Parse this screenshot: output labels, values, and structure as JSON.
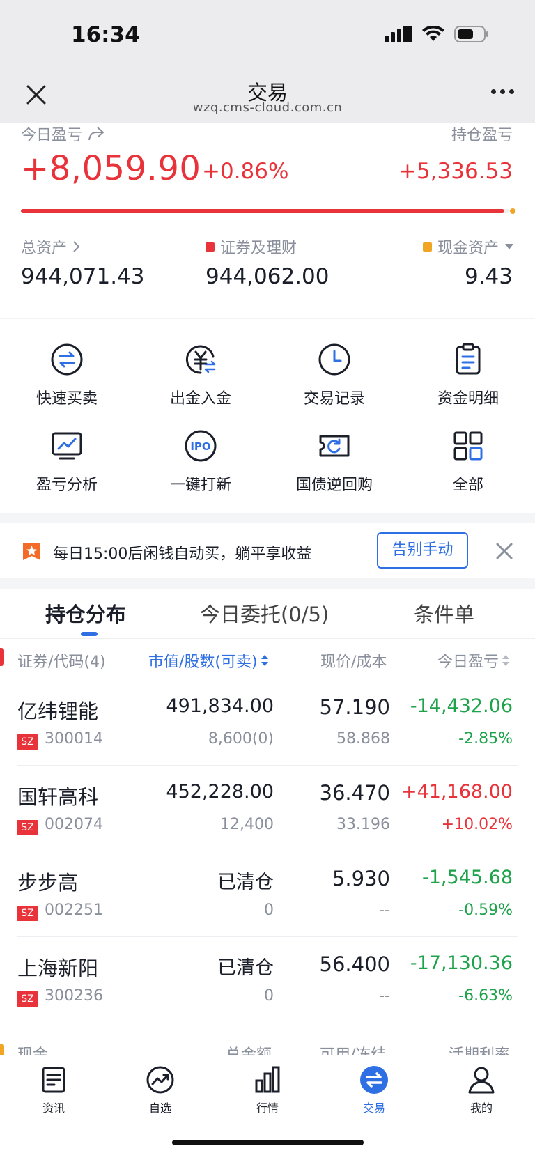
{
  "status": {
    "time": "16:34"
  },
  "nav": {
    "title": "交易",
    "url": "wzq.cms-cloud.com.cn"
  },
  "summary": {
    "today_pl_label": "今日盈亏",
    "holding_pl_label": "持仓盈亏",
    "today_pl": "+8,059.90",
    "today_pl_pct": "+0.86%",
    "holding_pl": "+5,336.53",
    "total_assets_label": "总资产",
    "securities_label": "证券及理财",
    "cash_label": "现金资产",
    "total_assets": "944,071.43",
    "securities_value": "944,062.00",
    "cash_value": "9.43",
    "securities_share": 0.99999
  },
  "shortcuts": [
    {
      "label": "快速买卖",
      "icon": "swap-circle-icon"
    },
    {
      "label": "出金入金",
      "icon": "yuan-transfer-icon"
    },
    {
      "label": "交易记录",
      "icon": "clock-icon"
    },
    {
      "label": "资金明细",
      "icon": "clipboard-icon"
    },
    {
      "label": "盈亏分析",
      "icon": "monitor-chart-icon"
    },
    {
      "label": "一键打新",
      "icon": "ipo-icon"
    },
    {
      "label": "国债逆回购",
      "icon": "ticket-refresh-icon"
    },
    {
      "label": "全部",
      "icon": "grid-icon"
    }
  ],
  "banner": {
    "text": "每日15:00后闲钱自动买，躺平享收益",
    "button": "告别手动"
  },
  "tabs": [
    "持仓分布",
    "今日委托(0/5)",
    "条件单"
  ],
  "table": {
    "headers": [
      "证券/代码(4)",
      "市值/股数(可卖)",
      "现价/成本",
      "今日盈亏"
    ],
    "rows": [
      {
        "name": "亿纬锂能",
        "market": "SZ",
        "code": "300014",
        "mv": "491,834.00",
        "shares": "8,600(0)",
        "price": "57.190",
        "cost": "58.868",
        "pl": "-14,432.06",
        "plp": "-2.85%"
      },
      {
        "name": "国轩高科",
        "market": "SZ",
        "code": "002074",
        "mv": "452,228.00",
        "shares": "12,400",
        "price": "36.470",
        "cost": "33.196",
        "pl": "+41,168.00",
        "plp": "+10.02%"
      },
      {
        "name": "步步高",
        "market": "SZ",
        "code": "002251",
        "mv": "已清仓",
        "shares": "0",
        "price": "5.930",
        "cost": "--",
        "pl": "-1,545.68",
        "plp": "-0.59%"
      },
      {
        "name": "上海新阳",
        "market": "SZ",
        "code": "300236",
        "mv": "已清仓",
        "shares": "0",
        "price": "56.400",
        "cost": "--",
        "pl": "-17,130.36",
        "plp": "-6.63%"
      }
    ]
  },
  "cash_section": {
    "headers": [
      "现金",
      "总金额",
      "可用/冻结",
      "活期利率"
    ]
  },
  "tabbar": [
    {
      "label": "资讯",
      "icon": "news-icon"
    },
    {
      "label": "自选",
      "icon": "trend-icon"
    },
    {
      "label": "行情",
      "icon": "bar-chart-icon"
    },
    {
      "label": "交易",
      "icon": "exchange-icon"
    },
    {
      "label": "我的",
      "icon": "user-icon"
    }
  ],
  "colors": {
    "up": "#e8333a",
    "down": "#1ea24a",
    "accent": "#2f6fe4",
    "cash": "#f0a524"
  }
}
